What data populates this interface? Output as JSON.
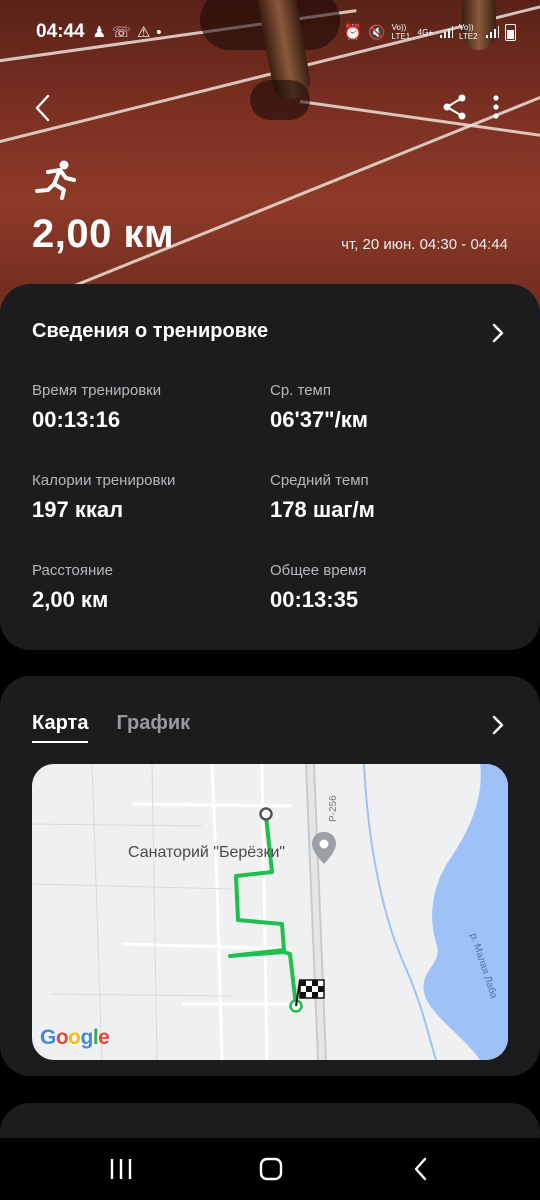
{
  "status_bar": {
    "time": "04:44",
    "left_icons": [
      "person-icon",
      "whatsapp-icon",
      "warning-icon",
      "dot-icon"
    ],
    "sim1_label": "Vo)) LTE1",
    "sim2_label": "Vo)) LTE2",
    "network_label": "4G+"
  },
  "header": {
    "activity_icon": "running-icon",
    "distance": "2,00 км",
    "date_range": "чт, 20 июн. 04:30 - 04:44"
  },
  "summary": {
    "title": "Сведения о тренировке",
    "stats": [
      {
        "label": "Время тренировки",
        "value": "00:13:16"
      },
      {
        "label": "Ср. темп",
        "value": "06'37\"/км"
      },
      {
        "label": "Калории тренировки",
        "value": "197 ккал"
      },
      {
        "label": "Средний темп",
        "value": "178 шаг/м"
      },
      {
        "label": "Расстояние",
        "value": "2,00 км"
      },
      {
        "label": "Общее время",
        "value": "00:13:35"
      }
    ]
  },
  "map_section": {
    "tabs": [
      {
        "label": "Карта",
        "active": true
      },
      {
        "label": "График",
        "active": false
      }
    ],
    "place_label": "Санаторий \"Берёзки\"",
    "river_label": "р. Малая Лаба",
    "road_label": "Р-256",
    "provider": "Google",
    "route_color": "#1fbf4e",
    "water_color": "#9ec1f7"
  },
  "navbar": {
    "buttons": [
      "recent-apps-icon",
      "home-icon",
      "back-icon"
    ]
  }
}
